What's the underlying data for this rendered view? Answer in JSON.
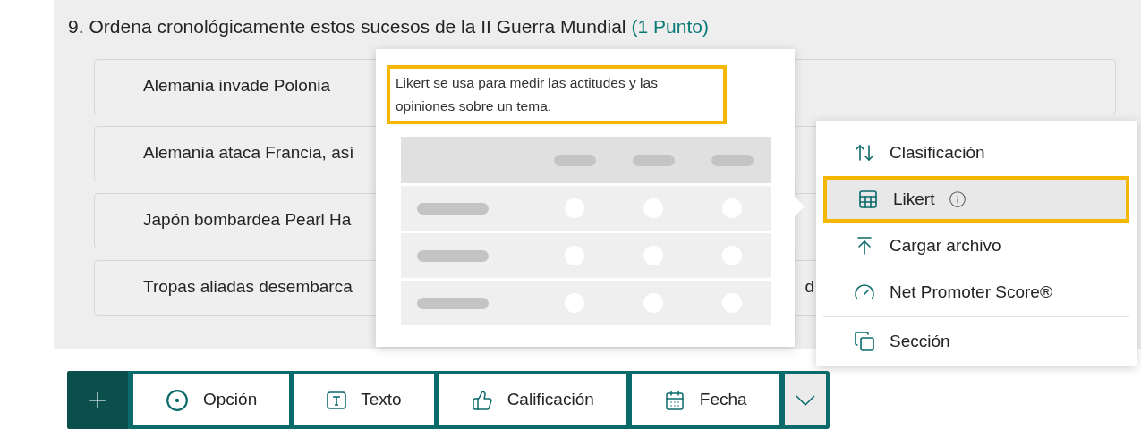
{
  "question": {
    "number": "9.",
    "title": "Ordena cronológicamente estos sucesos de la II Guerra Mundial",
    "points": "(1 Punto)",
    "items": [
      {
        "text": "Alemania invade Polonia"
      },
      {
        "text": "Alemania ataca Francia, así"
      },
      {
        "text": "Japón bombardea Pearl Ha"
      },
      {
        "text": "Tropas aliadas desembarca",
        "trailing": "d"
      }
    ]
  },
  "preview": {
    "description": "Likert se usa para medir las actitudes y las opiniones sobre un tema.",
    "highlighted": true
  },
  "menu": {
    "items": [
      {
        "kind": "ranking",
        "label": "Clasificación",
        "selected": false,
        "highlighted": false,
        "info": false
      },
      {
        "kind": "likert",
        "label": "Likert",
        "selected": true,
        "highlighted": true,
        "info": true
      },
      {
        "kind": "upload",
        "label": "Cargar archivo",
        "selected": false,
        "highlighted": false,
        "info": false
      },
      {
        "kind": "nps",
        "label": "Net Promoter Score®",
        "selected": false,
        "highlighted": false,
        "info": false
      },
      {
        "kind": "section",
        "label": "Sección",
        "selected": false,
        "highlighted": false,
        "info": false
      }
    ]
  },
  "toolbar": {
    "buttons": [
      {
        "kind": "choice",
        "label": "Opción"
      },
      {
        "kind": "text",
        "label": "Texto"
      },
      {
        "kind": "rating",
        "label": "Calificación"
      },
      {
        "kind": "date",
        "label": "Fecha"
      }
    ]
  }
}
